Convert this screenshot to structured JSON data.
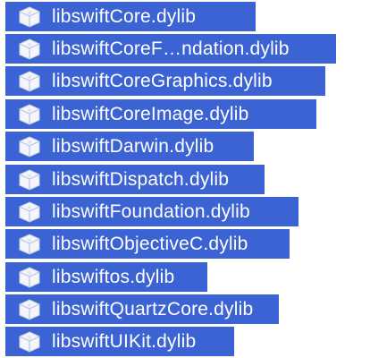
{
  "file_list": {
    "icon": "library-file-icon",
    "accent_color": "#3c63d4",
    "items": [
      {
        "name": "libswiftCore.dylib"
      },
      {
        "name": "libswiftCoreF…ndation.dylib"
      },
      {
        "name": "libswiftCoreGraphics.dylib"
      },
      {
        "name": "libswiftCoreImage.dylib"
      },
      {
        "name": "libswiftDarwin.dylib"
      },
      {
        "name": "libswiftDispatch.dylib"
      },
      {
        "name": "libswiftFoundation.dylib"
      },
      {
        "name": "libswiftObjectiveC.dylib"
      },
      {
        "name": "libswiftos.dylib"
      },
      {
        "name": "libswiftQuartzCore.dylib"
      },
      {
        "name": "libswiftUIKit.dylib"
      }
    ]
  }
}
